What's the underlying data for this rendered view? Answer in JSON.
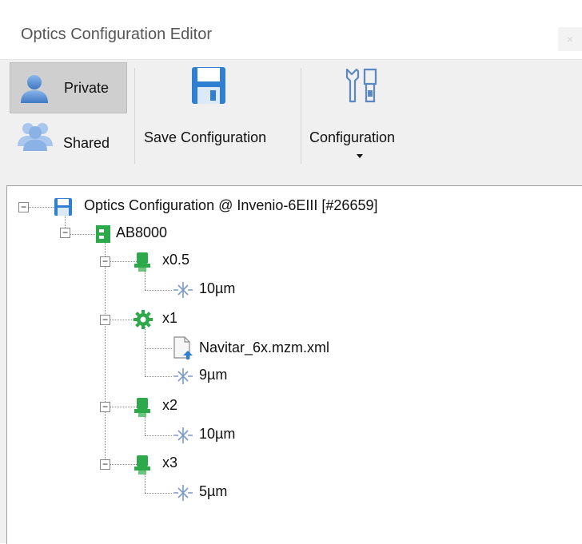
{
  "window": {
    "title": "Optics Configuration Editor",
    "close_glyph": "×"
  },
  "toolbar": {
    "private_label": "Private",
    "shared_label": "Shared",
    "save_label": "Save Configuration",
    "configuration_label": "Configuration"
  },
  "tree": {
    "root": "Optics Configuration @ Invenio-6EIII [#26659]",
    "device": "AB8000",
    "x05": {
      "label": "x0.5",
      "child": "10µm"
    },
    "x1": {
      "label": "x1",
      "file": "Navitar_6x.mzm.xml",
      "child": "9µm"
    },
    "x2": {
      "label": "x2",
      "child": "10µm"
    },
    "x3": {
      "label": "x3",
      "child": "5µm"
    }
  },
  "colors": {
    "accent_green": "#2da84a",
    "save_blue": "#2f7fd3",
    "selected_bg": "#cfcfcf"
  }
}
